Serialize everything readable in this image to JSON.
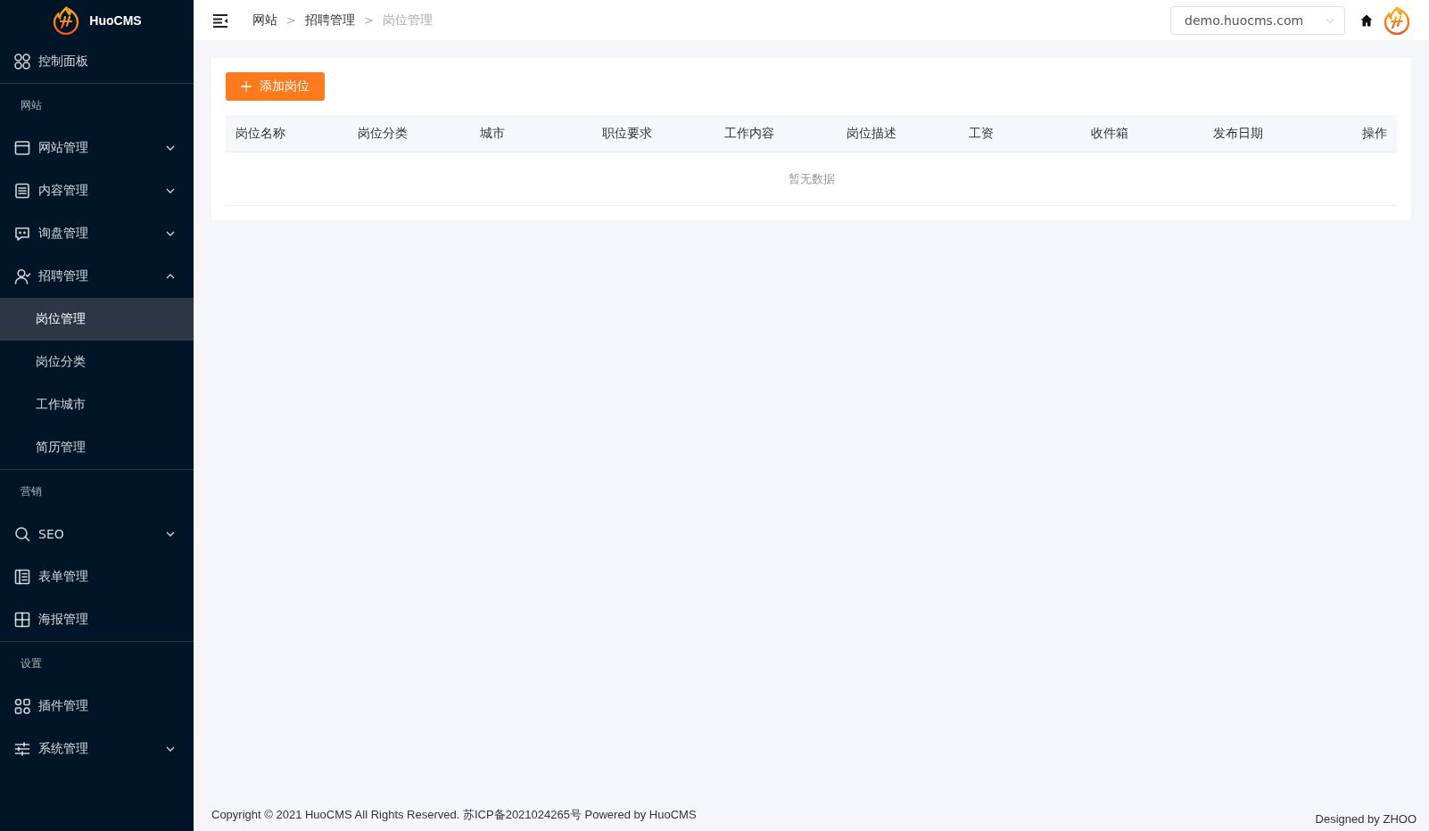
{
  "sidebar": {
    "brand": "HuoCMS",
    "menu": [
      {
        "kind": "item",
        "label": "控制面板"
      },
      {
        "kind": "section",
        "label": "网站"
      },
      {
        "kind": "item",
        "label": "网站管理",
        "expanded": false
      },
      {
        "kind": "item",
        "label": "内容管理",
        "expanded": false
      },
      {
        "kind": "item",
        "label": "询盘管理",
        "expanded": false
      },
      {
        "kind": "item",
        "label": "招聘管理",
        "expanded": true,
        "children": [
          {
            "label": "岗位管理",
            "selected": true
          },
          {
            "label": "岗位分类",
            "selected": false
          },
          {
            "label": "工作城市",
            "selected": false
          },
          {
            "label": "简历管理",
            "selected": false
          }
        ]
      },
      {
        "kind": "section",
        "label": "营销"
      },
      {
        "kind": "item",
        "label": "SEO",
        "expanded": false
      },
      {
        "kind": "item",
        "label": "表单管理"
      },
      {
        "kind": "item",
        "label": "海报管理"
      },
      {
        "kind": "section",
        "label": "设置"
      },
      {
        "kind": "item",
        "label": "插件管理"
      },
      {
        "kind": "item",
        "label": "系统管理",
        "expanded": false
      }
    ]
  },
  "header": {
    "breadcrumb": [
      "网站",
      "招聘管理",
      "岗位管理"
    ],
    "separator": ">",
    "site_select": "demo.huocms.com"
  },
  "content": {
    "add_button": "添加岗位",
    "table": {
      "columns": [
        "岗位名称",
        "岗位分类",
        "城市",
        "职位要求",
        "工作内容",
        "岗位描述",
        "工资",
        "收件箱",
        "发布日期",
        "操作"
      ],
      "empty_text": "暂无数据"
    }
  },
  "footer": {
    "copyright": "Copyright © 2021 HuoCMS All Rights Reserved. 苏ICP备2021024265号 Powered by HuoCMS",
    "designed_by": "Designed by ZHOO"
  }
}
